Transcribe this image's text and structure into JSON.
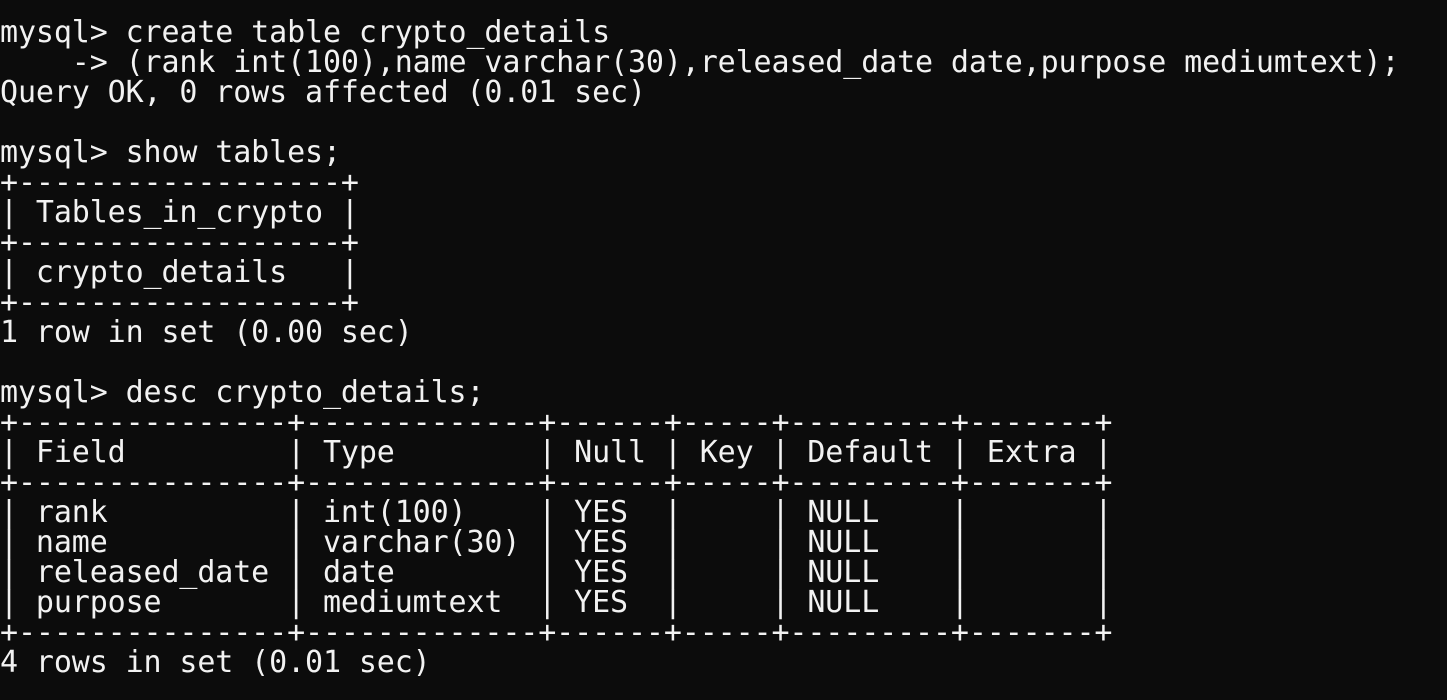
{
  "terminal": {
    "lines": [
      "mysql> create table crypto_details",
      "    -> (rank int(100),name varchar(30),released_date date,purpose mediumtext);",
      "Query OK, 0 rows affected (0.01 sec)",
      "",
      "mysql> show tables;",
      "+------------------+",
      "| Tables_in_crypto |",
      "+------------------+",
      "| crypto_details   |",
      "+------------------+",
      "1 row in set (0.00 sec)",
      "",
      "mysql> desc crypto_details;",
      "+---------------+-------------+------+-----+---------+-------+",
      "| Field         | Type        | Null | Key | Default | Extra |",
      "+---------------+-------------+------+-----+---------+-------+",
      "| rank          | int(100)    | YES  |     | NULL    |       |",
      "| name          | varchar(30) | YES  |     | NULL    |       |",
      "| released_date | date        | YES  |     | NULL    |       |",
      "| purpose       | mediumtext  | YES  |     | NULL    |       |",
      "+---------------+-------------+------+-----+---------+-------+",
      "4 rows in set (0.01 sec)"
    ]
  },
  "colors": {
    "background": "#0c0c0c",
    "foreground": "#f2f2f2"
  }
}
